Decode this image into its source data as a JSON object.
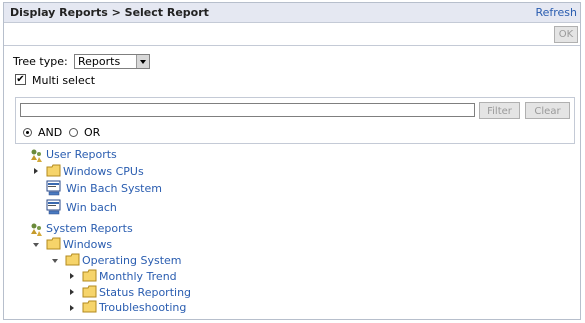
{
  "header": {
    "title": "Display Reports > Select Report",
    "refresh_label": "Refresh"
  },
  "ok_label": "OK",
  "tree_type": {
    "label": "Tree type:",
    "selected": "Reports"
  },
  "multi_select": {
    "label": "Multi select",
    "checked": true,
    "check_glyph": "✔"
  },
  "filter": {
    "value": "",
    "filter_label": "Filter",
    "clear_label": "Clear",
    "and_label": "AND",
    "or_label": "OR",
    "selected": "AND"
  },
  "tree": {
    "user_reports": "User Reports",
    "windows_cpus": "Windows CPUs",
    "win_bach_system": "Win Bach System",
    "win_bach": "Win bach",
    "system_reports": "System Reports",
    "windows": "Windows",
    "operating_system": "Operating System",
    "monthly_trend": "Monthly Trend",
    "status_reporting": "Status Reporting",
    "troubleshooting": "Troubleshooting"
  }
}
